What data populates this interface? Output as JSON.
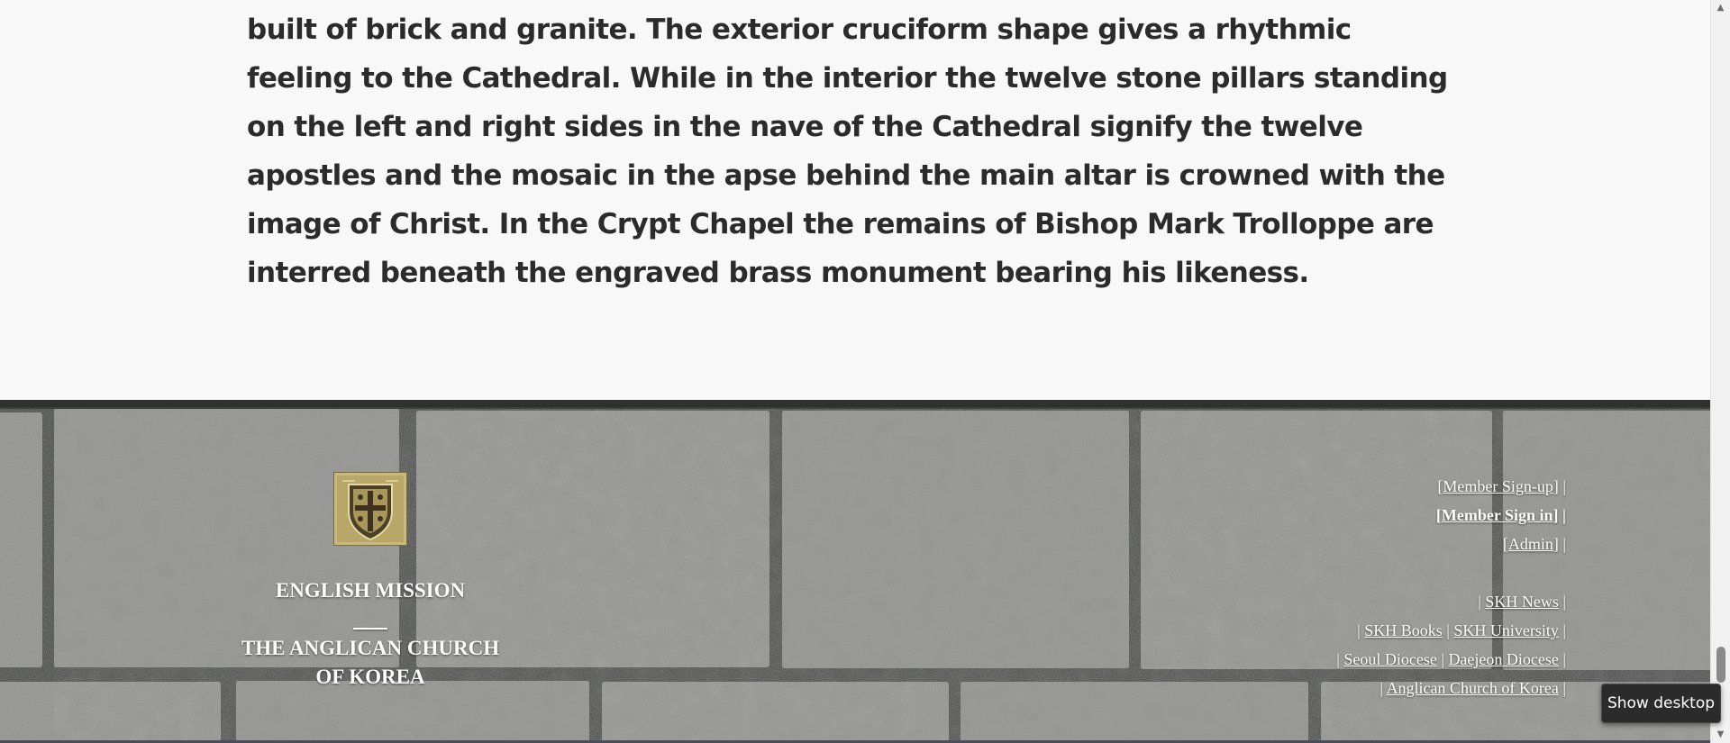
{
  "article": {
    "paragraph": "built of brick and granite. The exterior cruciform shape gives a rhythmic feeling to the Cathedral. While in the interior the twelve stone pillars standing on the left and right sides in the nave of the Cathedral signify the twelve apostles and the mosaic in the apse behind the main altar is crowned with the image of Christ. In the Crypt Chapel the remains of Bishop Mark Trolloppe are interred beneath the engraved brass monument bearing his likeness."
  },
  "footer": {
    "logo_icon": "shield-cross-crest-icon",
    "title_line1": "ENGLISH MISSION",
    "title_line2": "THE ANGLICAN CHURCH",
    "title_line3": "OF KOREA",
    "account_links": {
      "member_signup": "Member Sign-up",
      "member_signin": "Member Sign in",
      "admin": "Admin"
    },
    "resource_links": {
      "skh_news": "SKH News",
      "skh_books": "SKH Books",
      "skh_university": "SKH University",
      "seoul_diocese": "Seoul Diocese",
      "daejeon_diocese": "Daejeon Diocese",
      "anglican_church_of_korea": "Anglican Church of Korea"
    },
    "separator": "|",
    "bracket_open": "[",
    "bracket_close": "]"
  },
  "tooltip": {
    "text": "Show desktop"
  },
  "colors": {
    "page_background": "#f8f8f8",
    "article_text": "#2b2b2b",
    "footer_text": "#ffffff",
    "granite": "#959595",
    "grout": "#3c3e3c",
    "crest_gold": "#b9a76a",
    "tooltip_background": "#2b2b2b"
  }
}
